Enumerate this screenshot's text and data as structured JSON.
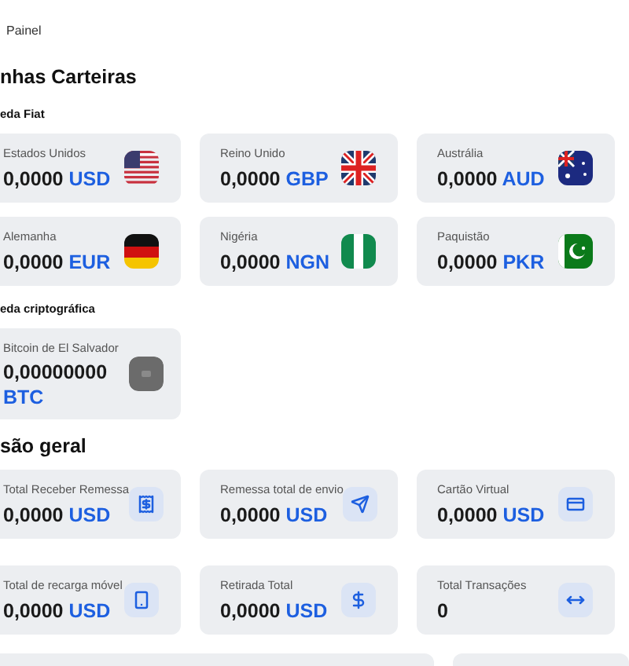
{
  "breadcrumb": "Painel",
  "wallets": {
    "title": "nhas Carteiras",
    "sections": [
      {
        "title": "eda Fiat",
        "cards": [
          {
            "country": "Estados Unidos",
            "amount": "0,0000",
            "currency": "USD"
          },
          {
            "country": "Reino Unido",
            "amount": "0,0000",
            "currency": "GBP"
          },
          {
            "country": "Austrália",
            "amount": "0,0000",
            "currency": "AUD"
          },
          {
            "country": "Alemanha",
            "amount": "0,0000",
            "currency": "EUR"
          },
          {
            "country": "Nigéria",
            "amount": "0,0000",
            "currency": "NGN"
          },
          {
            "country": "Paquistão",
            "amount": "0,0000",
            "currency": "PKR"
          }
        ]
      },
      {
        "title": "eda criptográfica",
        "cards": [
          {
            "country": "Bitcoin de El Salvador",
            "amount": "0,00000000",
            "currency": "BTC"
          }
        ]
      }
    ]
  },
  "overview": {
    "title": "são geral",
    "cards": [
      {
        "label": "Total Receber Remessa",
        "amount": "0,0000",
        "currency": "USD"
      },
      {
        "label": "Remessa total de envio",
        "amount": "0,0000",
        "currency": "USD"
      },
      {
        "label": "Cartão Virtual",
        "amount": "0,0000",
        "currency": "USD"
      },
      {
        "label": "Total de recarga móvel",
        "amount": "0,0000",
        "currency": "USD"
      },
      {
        "label": "Retirada Total",
        "amount": "0,0000",
        "currency": "USD"
      },
      {
        "label": "Total Transações",
        "amount": "0"
      }
    ]
  }
}
